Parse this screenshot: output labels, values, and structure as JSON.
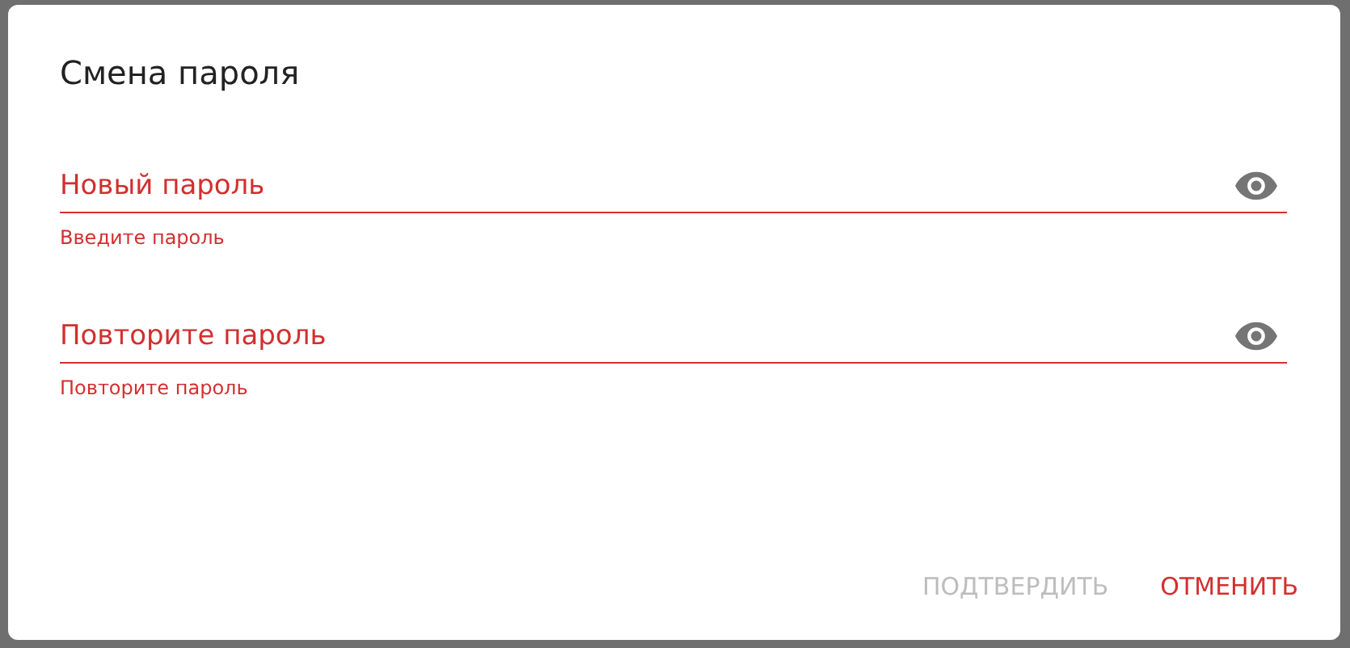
{
  "dialog": {
    "title": "Смена пароля"
  },
  "fields": [
    {
      "label": "Новый пароль",
      "error": true,
      "hint": "Введите пароль"
    },
    {
      "label": "Повторите пароль",
      "error": true,
      "hint": "Повторите пароль"
    }
  ],
  "actions": [
    {
      "label": "ПОДТВЕРДИТЬ",
      "disabled": true
    },
    {
      "label": "ОТМЕНИТЬ",
      "disabled": false
    }
  ]
}
